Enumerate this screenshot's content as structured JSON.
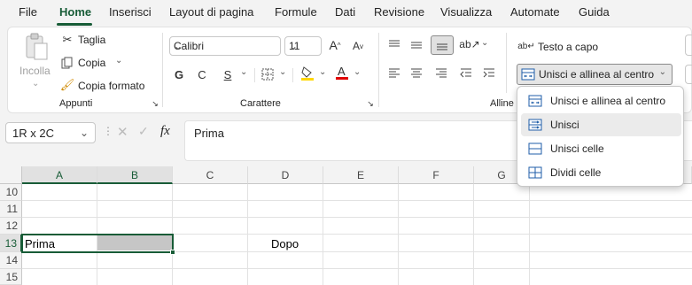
{
  "menu": {
    "items": [
      "File",
      "Home",
      "Inserisci",
      "Layout di pagina",
      "Formule",
      "Dati",
      "Revisione",
      "Visualizza",
      "Automate",
      "Guida"
    ],
    "active": "Home"
  },
  "ribbon": {
    "clipboard": {
      "paste": "Incolla",
      "cut": "Taglia",
      "copy": "Copia",
      "format_painter": "Copia formato",
      "group": "Appunti"
    },
    "font": {
      "name": "Calibri",
      "size": "11",
      "bold": "G",
      "italic": "C",
      "underline": "S",
      "group": "Carattere"
    },
    "alignment": {
      "wrap": "Testo a capo",
      "merge": "Unisci e allinea al centro",
      "group": "Alline"
    }
  },
  "dropdown": {
    "items": [
      {
        "label": "Unisci e allinea al centro",
        "icon": "merge-center-icon"
      },
      {
        "label": "Unisci",
        "icon": "merge-across-icon"
      },
      {
        "label": "Unisci celle",
        "icon": "merge-cells-icon"
      },
      {
        "label": "Dividi celle",
        "icon": "unmerge-cells-icon"
      }
    ],
    "hover_index": 1
  },
  "formula_bar": {
    "name_box": "1R x 2C",
    "fx": "fx",
    "content": "Prima"
  },
  "sheet": {
    "columns": [
      "A",
      "B",
      "C",
      "D",
      "E",
      "F",
      "G"
    ],
    "rows": [
      "10",
      "11",
      "12",
      "13",
      "14",
      "15"
    ],
    "selected_row": "13",
    "cells": {
      "A13": "Prima",
      "D13": "Dopo"
    }
  },
  "colors": {
    "accent": "#185c37",
    "selection_fill": "#c6c6c6"
  }
}
